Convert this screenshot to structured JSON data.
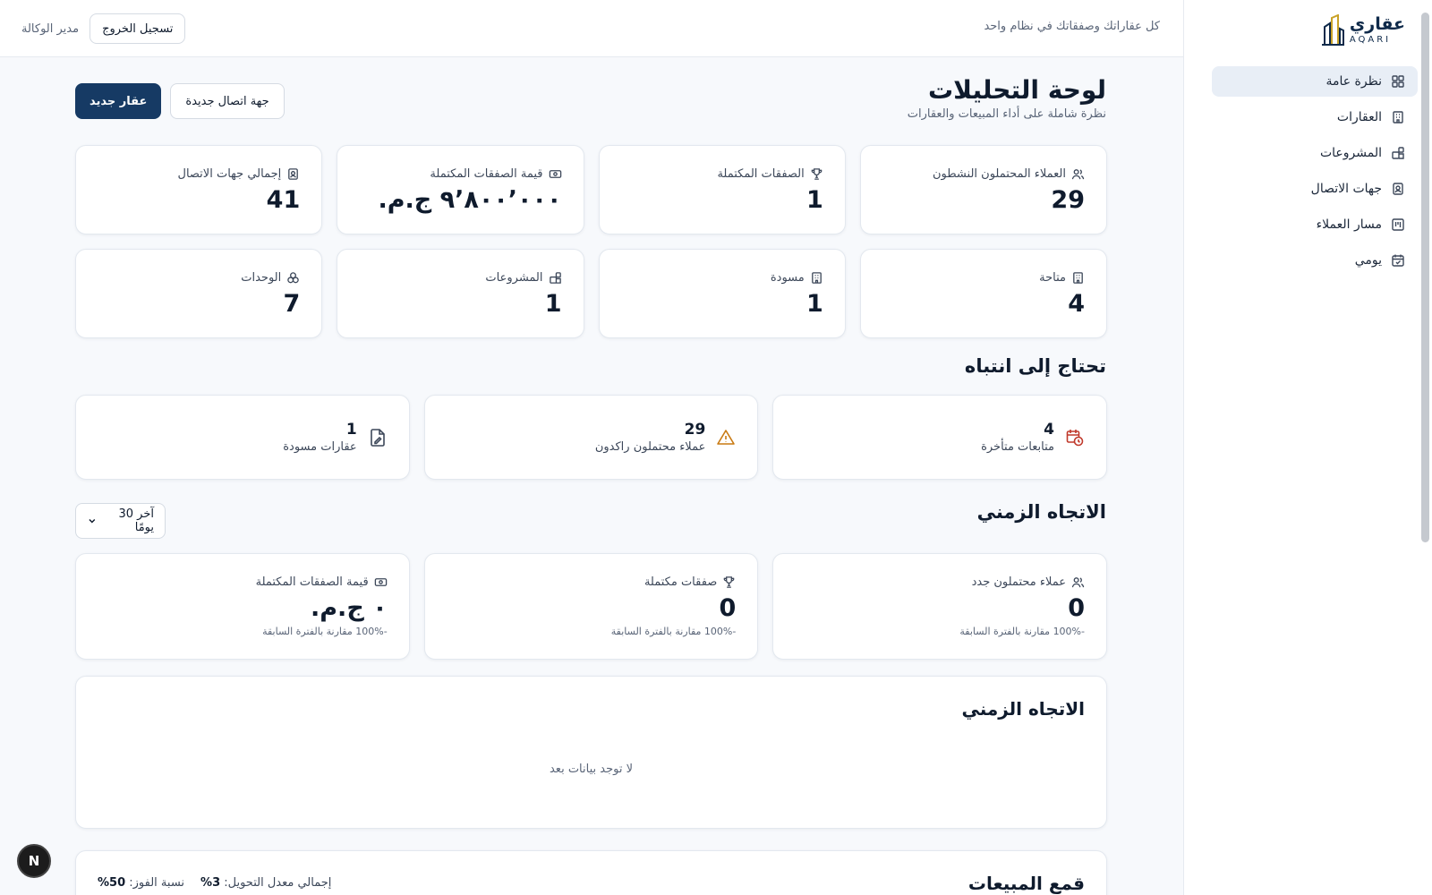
{
  "app": {
    "logo_ar": "عقاري",
    "logo_en": "AQARI",
    "tagline": "كل عقاراتك وصفقاتك في نظام واحد",
    "role": "مدير الوكالة",
    "logout_label": "تسجيل الخروج",
    "badge_letter": "N"
  },
  "colors": {
    "primary": "#163a64",
    "accent_gold": "#c9a227",
    "alert_red": "#c0392b",
    "alert_amber": "#c97a12",
    "active_nav_bg": "#e8eef6"
  },
  "sidebar": {
    "items": [
      {
        "label": "نظرة عامة",
        "icon": "grid-icon",
        "active": true
      },
      {
        "label": "العقارات",
        "icon": "building-icon"
      },
      {
        "label": "المشروعات",
        "icon": "blocks-icon"
      },
      {
        "label": "جهات الاتصال",
        "icon": "contact-card-icon"
      },
      {
        "label": "مسار العملاء",
        "icon": "kanban-icon"
      },
      {
        "label": "يومي",
        "icon": "calendar-check-icon"
      }
    ]
  },
  "header": {
    "title": "لوحة التحليلات",
    "subtitle": "نظرة شاملة على أداء المبيعات والعقارات",
    "new_property": "عقار جديد",
    "new_contact": "جهة اتصال جديدة"
  },
  "stats": [
    {
      "label": "العملاء المحتملون النشطون",
      "value": "29",
      "icon": "users-icon"
    },
    {
      "label": "الصفقات المكتملة",
      "value": "1",
      "icon": "trophy-icon"
    },
    {
      "label": "قيمة الصفقات المكتملة",
      "value": "٩٬٨٠٠٬٠٠٠ ج.م.",
      "icon": "banknote-icon"
    },
    {
      "label": "إجمالي جهات الاتصال",
      "value": "41",
      "icon": "contact-card-icon"
    },
    {
      "label": "متاحة",
      "value": "4",
      "icon": "building-icon"
    },
    {
      "label": "مسودة",
      "value": "1",
      "icon": "building-icon"
    },
    {
      "label": "المشروعات",
      "value": "1",
      "icon": "blocks-icon"
    },
    {
      "label": "الوحدات",
      "value": "7",
      "icon": "units-icon"
    }
  ],
  "attention": {
    "title": "تحتاج إلى انتباه",
    "items": [
      {
        "value": "4",
        "label": "متابعات متأخرة",
        "icon": "calendar-clock-icon"
      },
      {
        "value": "29",
        "label": "عملاء محتملون راكدون",
        "icon": "warning-icon"
      },
      {
        "value": "1",
        "label": "عقارات مسودة",
        "icon": "file-edit-icon"
      }
    ]
  },
  "trend": {
    "title": "الاتجاه الزمني",
    "period": "آخر 30 يومًا",
    "items": [
      {
        "label": "عملاء محتملون جدد",
        "value": "0",
        "compare": "-100% مقارنة بالفترة السابقة",
        "icon": "users-icon"
      },
      {
        "label": "صفقات مكتملة",
        "value": "0",
        "compare": "-100% مقارنة بالفترة السابقة",
        "icon": "trophy-icon"
      },
      {
        "label": "قيمة الصفقات المكتملة",
        "value": "٠ ج.م.",
        "compare": "-100% مقارنة بالفترة السابقة",
        "icon": "banknote-icon"
      }
    ]
  },
  "chart": {
    "title": "الاتجاه الزمني",
    "empty_text": "لا توجد بيانات بعد"
  },
  "funnel": {
    "title": "قمع المبيعات",
    "win_rate_label": "نسبة الفوز:",
    "win_rate_value": "50%",
    "conversion_label": "إجمالي معدل التحويل:",
    "conversion_value": "3%"
  }
}
